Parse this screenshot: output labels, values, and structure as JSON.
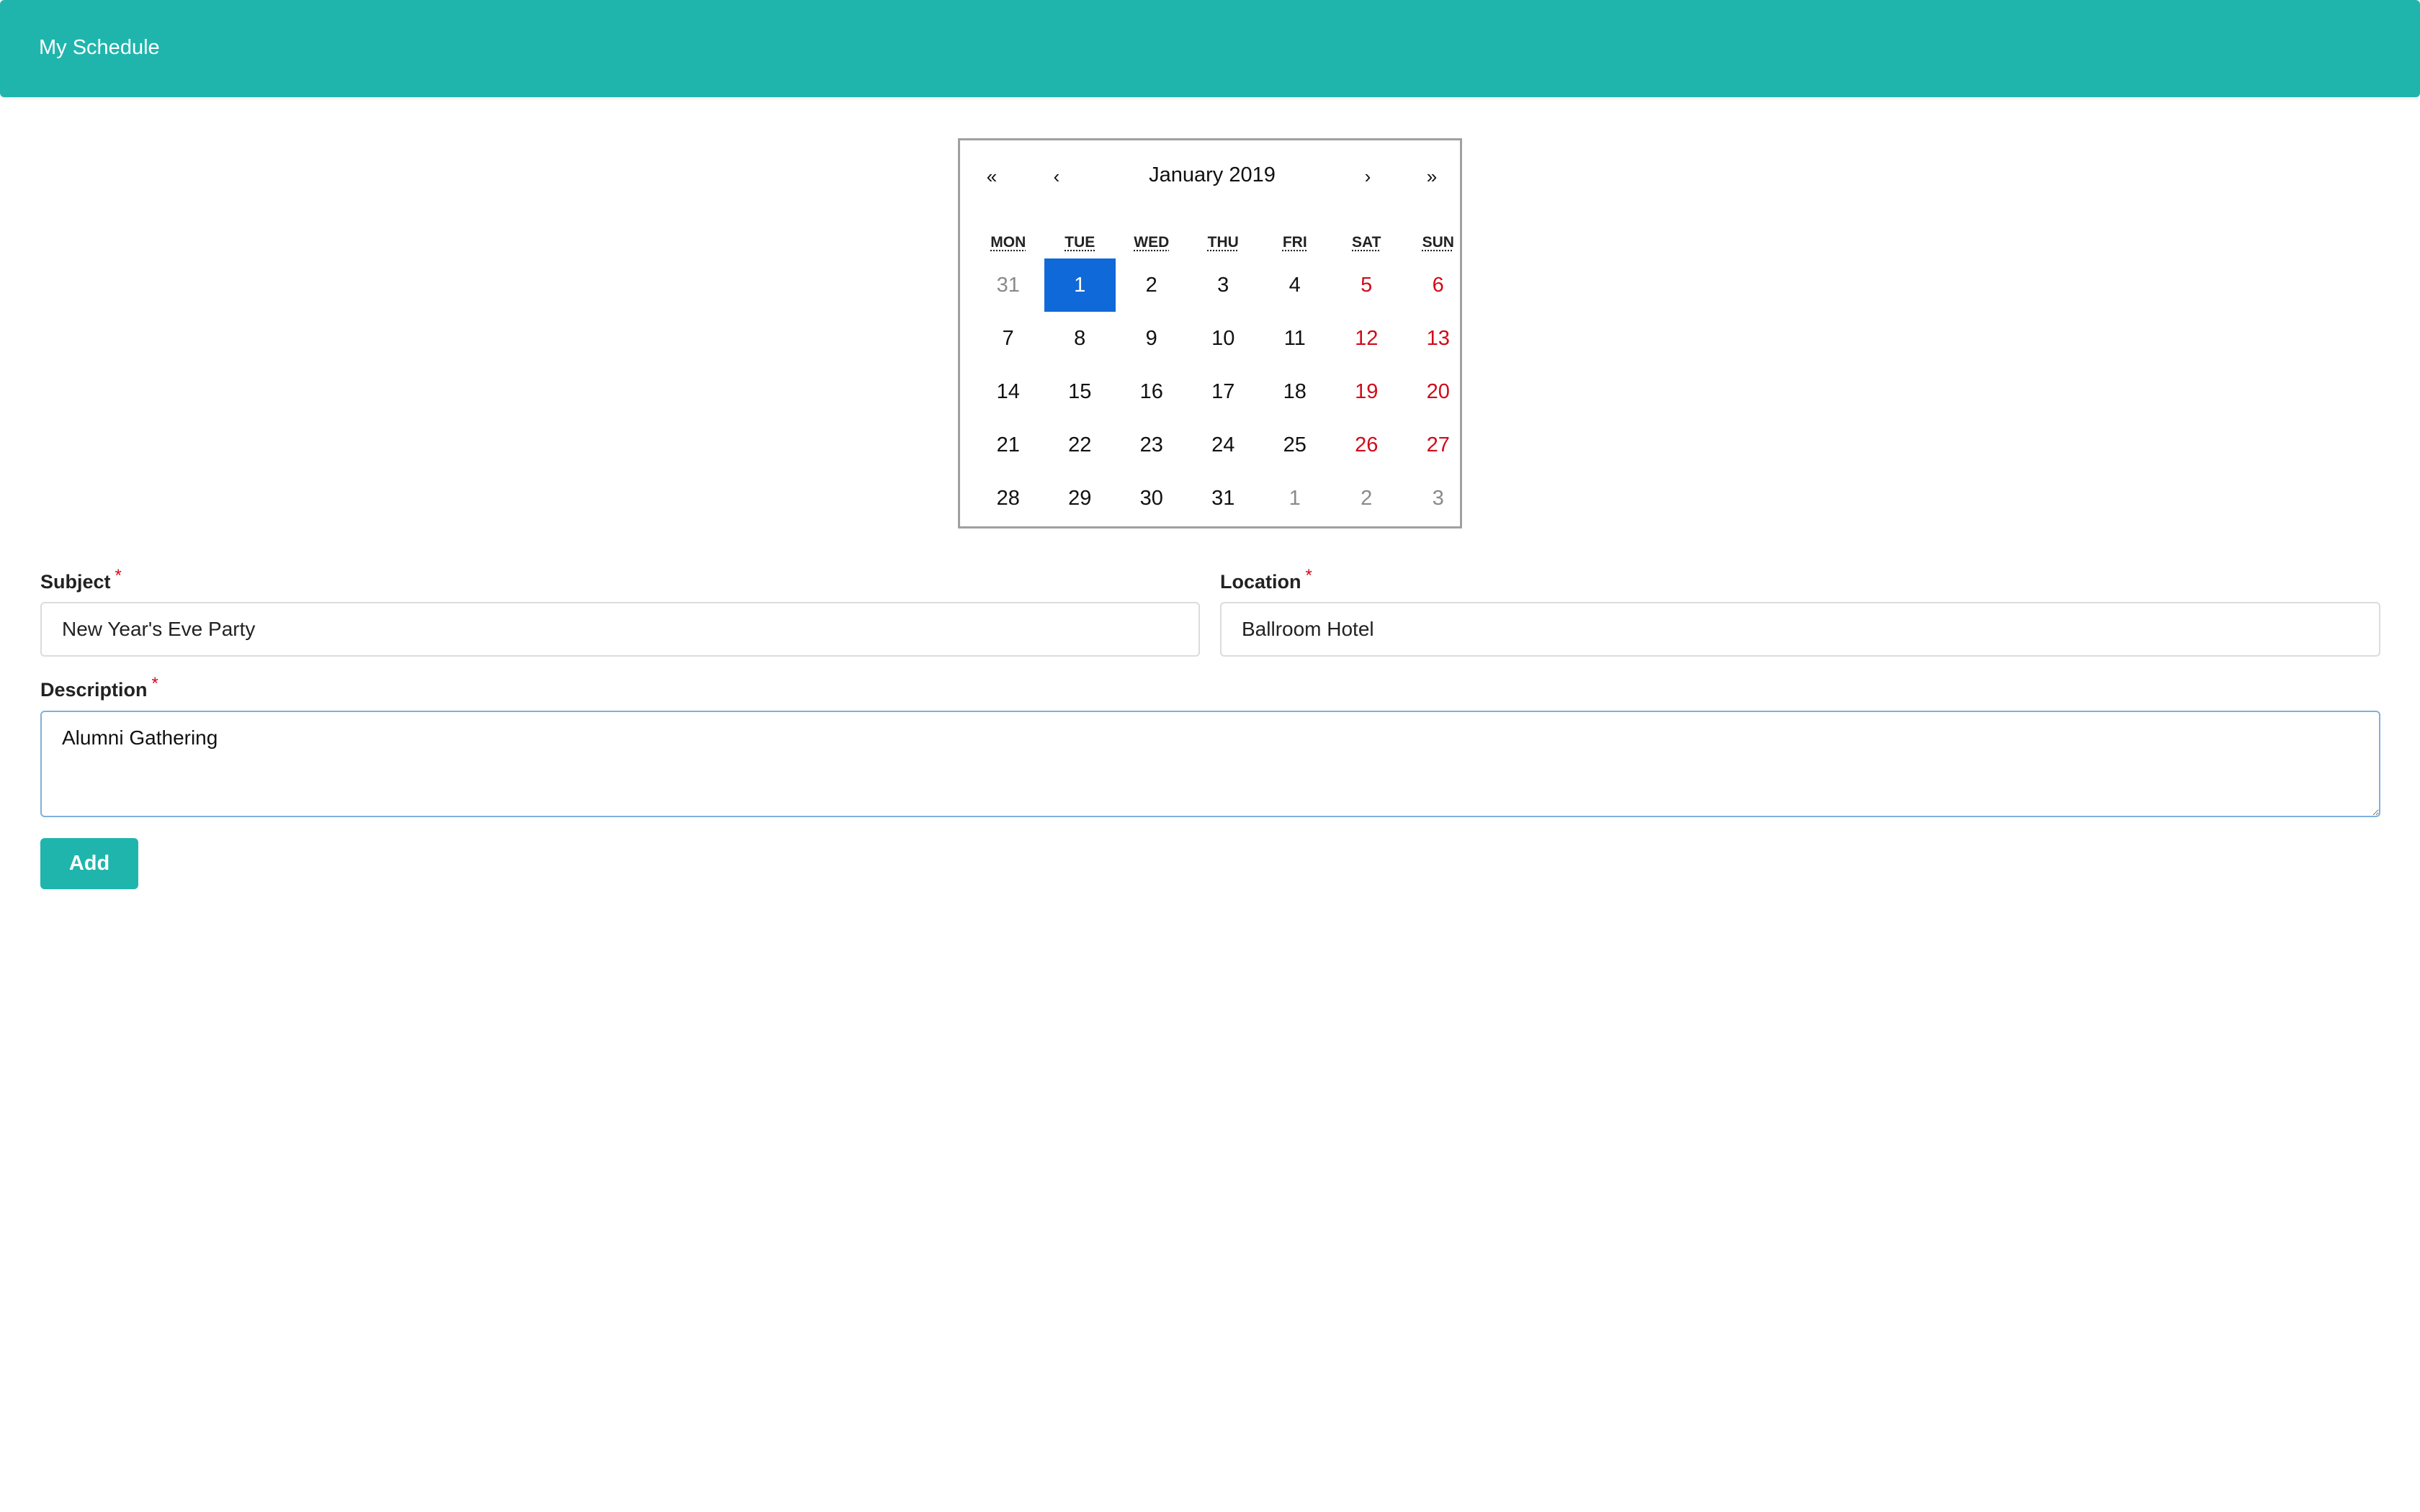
{
  "header": {
    "brand": "My Schedule"
  },
  "calendar": {
    "title": "January 2019",
    "nav": {
      "prev_year": "«",
      "prev_month": "‹",
      "next_month": "›",
      "next_year": "»"
    },
    "weekdays": [
      "MON",
      "TUE",
      "WED",
      "THU",
      "FRI",
      "SAT",
      "SUN"
    ],
    "weeks": [
      [
        {
          "d": "31",
          "t": "other"
        },
        {
          "d": "1",
          "t": "selected"
        },
        {
          "d": "2",
          "t": ""
        },
        {
          "d": "3",
          "t": ""
        },
        {
          "d": "4",
          "t": ""
        },
        {
          "d": "5",
          "t": "weekend"
        },
        {
          "d": "6",
          "t": "weekend"
        }
      ],
      [
        {
          "d": "7",
          "t": ""
        },
        {
          "d": "8",
          "t": ""
        },
        {
          "d": "9",
          "t": ""
        },
        {
          "d": "10",
          "t": ""
        },
        {
          "d": "11",
          "t": ""
        },
        {
          "d": "12",
          "t": "weekend"
        },
        {
          "d": "13",
          "t": "weekend"
        }
      ],
      [
        {
          "d": "14",
          "t": ""
        },
        {
          "d": "15",
          "t": ""
        },
        {
          "d": "16",
          "t": ""
        },
        {
          "d": "17",
          "t": ""
        },
        {
          "d": "18",
          "t": ""
        },
        {
          "d": "19",
          "t": "weekend"
        },
        {
          "d": "20",
          "t": "weekend"
        }
      ],
      [
        {
          "d": "21",
          "t": ""
        },
        {
          "d": "22",
          "t": ""
        },
        {
          "d": "23",
          "t": ""
        },
        {
          "d": "24",
          "t": ""
        },
        {
          "d": "25",
          "t": ""
        },
        {
          "d": "26",
          "t": "weekend"
        },
        {
          "d": "27",
          "t": "weekend"
        }
      ],
      [
        {
          "d": "28",
          "t": ""
        },
        {
          "d": "29",
          "t": ""
        },
        {
          "d": "30",
          "t": ""
        },
        {
          "d": "31",
          "t": ""
        },
        {
          "d": "1",
          "t": "other"
        },
        {
          "d": "2",
          "t": "other"
        },
        {
          "d": "3",
          "t": "other"
        }
      ]
    ]
  },
  "form": {
    "subject_label": "Subject",
    "subject_value": "New Year's Eve Party",
    "location_label": "Location",
    "location_value": "Ballroom Hotel",
    "description_label": "Description",
    "description_value": "Alumni Gathering",
    "required_mark": "*",
    "add_label": "Add"
  },
  "colors": {
    "accent": "#1fb5ad",
    "selected": "#1069d8",
    "weekend": "#d10a1a",
    "required": "#d10a1a"
  }
}
